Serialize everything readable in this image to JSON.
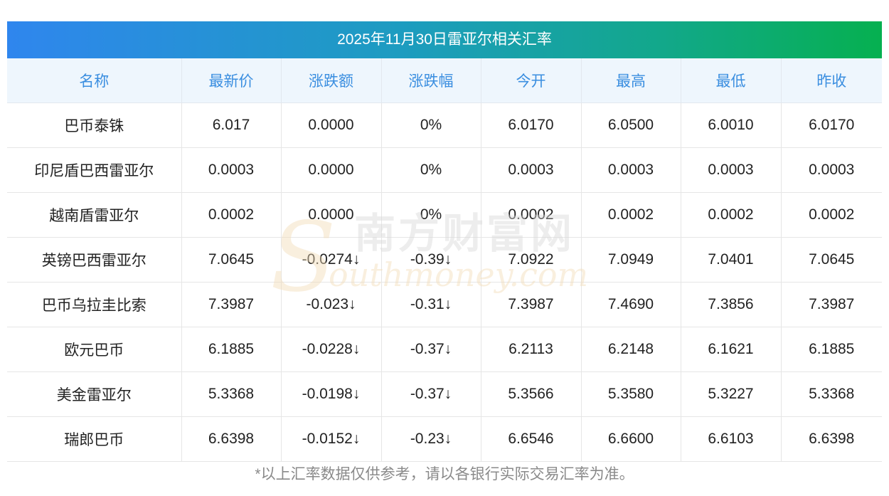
{
  "title": "2025年11月30日雷亚尔相关汇率",
  "columns": [
    "名称",
    "最新价",
    "涨跌额",
    "涨跌幅",
    "今开",
    "最高",
    "最低",
    "昨收"
  ],
  "rows": [
    {
      "name": "巴币泰铢",
      "latest": "6.017",
      "change": "0.0000",
      "change_pct": "0%",
      "open": "6.0170",
      "high": "6.0500",
      "low": "6.0010",
      "prev_close": "6.0170",
      "down": false
    },
    {
      "name": "印尼盾巴西雷亚尔",
      "latest": "0.0003",
      "change": "0.0000",
      "change_pct": "0%",
      "open": "0.0003",
      "high": "0.0003",
      "low": "0.0003",
      "prev_close": "0.0003",
      "down": false
    },
    {
      "name": "越南盾雷亚尔",
      "latest": "0.0002",
      "change": "0.0000",
      "change_pct": "0%",
      "open": "0.0002",
      "high": "0.0002",
      "low": "0.0002",
      "prev_close": "0.0002",
      "down": false
    },
    {
      "name": "英镑巴西雷亚尔",
      "latest": "7.0645",
      "change": "-0.0274↓",
      "change_pct": "-0.39↓",
      "open": "7.0922",
      "high": "7.0949",
      "low": "7.0401",
      "prev_close": "7.0645",
      "down": true
    },
    {
      "name": "巴币乌拉圭比索",
      "latest": "7.3987",
      "change": "-0.023↓",
      "change_pct": "-0.31↓",
      "open": "7.3987",
      "high": "7.4690",
      "low": "7.3856",
      "prev_close": "7.3987",
      "down": true
    },
    {
      "name": "欧元巴币",
      "latest": "6.1885",
      "change": "-0.0228↓",
      "change_pct": "-0.37↓",
      "open": "6.2113",
      "high": "6.2148",
      "low": "6.1621",
      "prev_close": "6.1885",
      "down": true
    },
    {
      "name": "美金雷亚尔",
      "latest": "5.3368",
      "change": "-0.0198↓",
      "change_pct": "-0.37↓",
      "open": "5.3566",
      "high": "5.3580",
      "low": "5.3227",
      "prev_close": "5.3368",
      "down": true
    },
    {
      "name": "瑞郎巴币",
      "latest": "6.6398",
      "change": "-0.0152↓",
      "change_pct": "-0.23↓",
      "open": "6.6546",
      "high": "6.6600",
      "low": "6.6103",
      "prev_close": "6.6398",
      "down": true
    }
  ],
  "watermark": {
    "cn": "南方财富网",
    "en": "outhmoney.com",
    "letter": "S"
  },
  "footnote": "*以上汇率数据仅供参考，请以各银行实际交易汇率为准。",
  "colors": {
    "title_gradient_start": "#2f86ee",
    "title_gradient_end": "#06b050",
    "header_bg": "#eef6fd",
    "header_text": "#3a8ee0",
    "down_text": "#1c8a1c",
    "watermark": "#f3dcb8"
  }
}
